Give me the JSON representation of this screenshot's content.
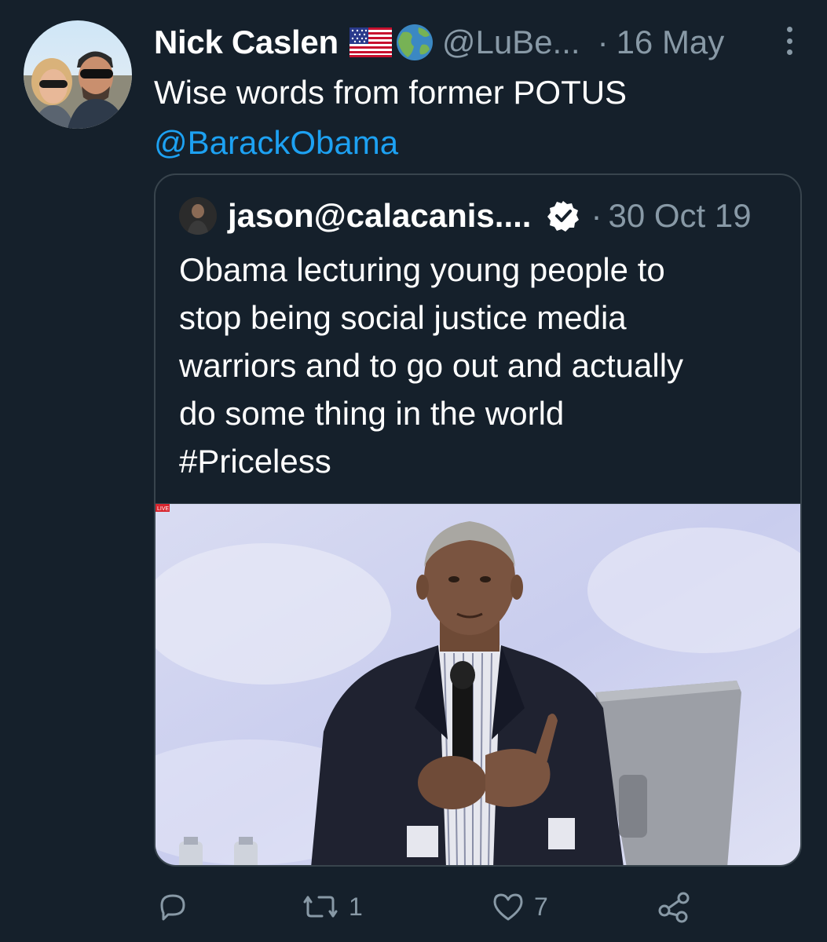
{
  "tweet": {
    "display_name": "Nick Caslen",
    "flag_emoji": "🇺🇸",
    "globe_emoji": "🌎",
    "handle": "@LuBe...",
    "separator": "·",
    "timestamp": "16 May",
    "text_line1": "Wise words from former POTUS",
    "mention": "@BarackObama"
  },
  "quoted_tweet": {
    "display_name": "jason@calacanis....",
    "separator": "·",
    "timestamp": "30 Oct 19",
    "text_lines": [
      "Obama lecturing young people to",
      "stop being social justice media",
      "warriors and to go out and actually",
      "do some thing in the world",
      "#Priceless"
    ],
    "media_badge": "LIVE"
  },
  "actions": {
    "reply_icon": "reply-icon",
    "retweet_count": "1",
    "like_count": "7",
    "share_icon": "share-icon"
  },
  "colors": {
    "background": "#15202b",
    "secondary_text": "#8899a6",
    "link": "#1da1f2",
    "border": "#38444d"
  }
}
